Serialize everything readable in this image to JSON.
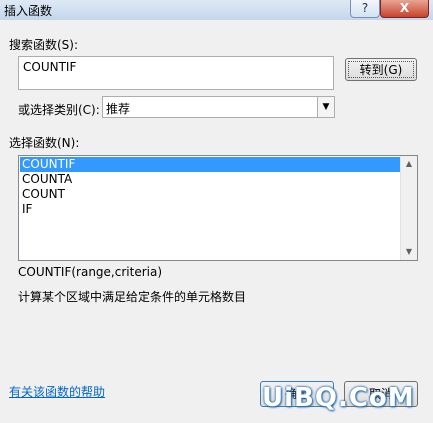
{
  "window": {
    "title": "插入函数",
    "help_glyph": "?",
    "close_glyph": "X"
  },
  "search": {
    "label": "搜索函数(S):",
    "value": "COUNTIF",
    "goto_button": "转到(G)"
  },
  "category": {
    "label": "或选择类别(C):",
    "selected": "推荐"
  },
  "function_list": {
    "label": "选择函数(N):",
    "items": [
      "COUNTIF",
      "COUNTA",
      "COUNT",
      "IF"
    ],
    "selected_index": 0
  },
  "details": {
    "syntax": "COUNTIF(range,criteria)",
    "description": "计算某个区域中满足给定条件的单元格数目"
  },
  "footer": {
    "help_link": "有关该函数的帮助",
    "ok_button": "确定",
    "cancel_button": "取消"
  },
  "watermark": "UiBQ.CoM",
  "colors": {
    "selection": "#3399ff",
    "link": "#0066cc",
    "close": "#c7432c"
  }
}
